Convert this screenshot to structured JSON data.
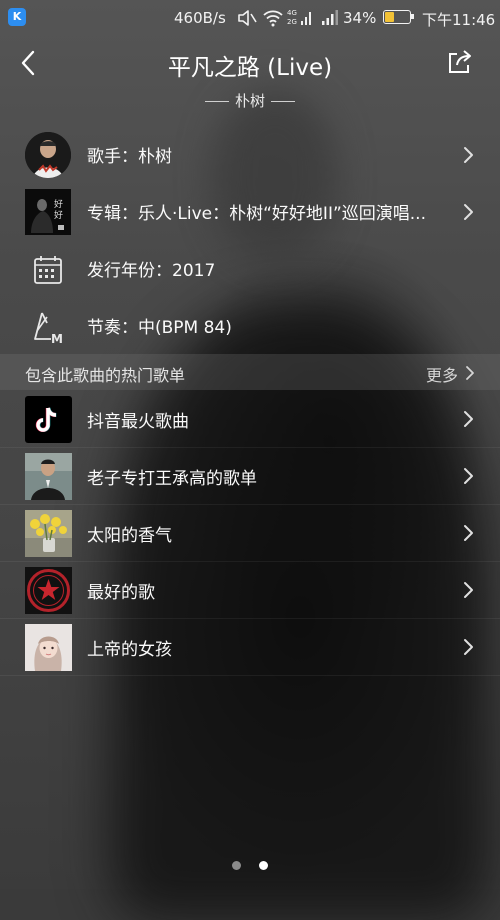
{
  "status_bar": {
    "app_icon_letter": "K",
    "network_speed": "460B/s",
    "battery_percent": "34%",
    "battery_level": 0.34,
    "time": "下午11:46",
    "network_type_top": "4G",
    "network_type_bottom": "2G"
  },
  "header": {
    "title": "平凡之路 (Live)",
    "subtitle": "朴树",
    "back_icon": "chevron-left-icon",
    "share_icon": "share-icon"
  },
  "info": {
    "singer": "歌手：朴树",
    "album": "专辑：乐人·Live：朴树“好好地II”巡回演唱...",
    "year": "发行年份：2017",
    "tempo": "节奏：中(BPM 84)"
  },
  "playlists_section": {
    "title": "包含此歌曲的热门歌单",
    "more_label": "更多"
  },
  "playlists": [
    {
      "name": "抖音最火歌曲",
      "thumb": "tiktok-logo"
    },
    {
      "name": "老子专打王承高的歌单",
      "thumb": "man-in-suit"
    },
    {
      "name": "太阳的香气",
      "thumb": "yellow-flowers"
    },
    {
      "name": "最好的歌",
      "thumb": "red-star-badge"
    },
    {
      "name": "上帝的女孩",
      "thumb": "girl-portrait"
    }
  ],
  "pager": {
    "count": 2,
    "active": 2
  },
  "colors": {
    "accent_yellow": "#f3c236",
    "tiktok_cyan": "#25f4ee",
    "tiktok_red": "#fe2c55"
  }
}
